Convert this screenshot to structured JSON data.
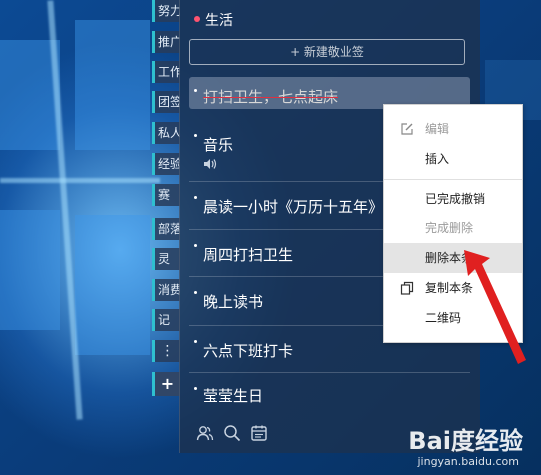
{
  "side_tabs": [
    {
      "label": "努力"
    },
    {
      "label": "推广"
    },
    {
      "label": "工作"
    },
    {
      "label": "团签"
    },
    {
      "label": "私人"
    },
    {
      "label": "经验"
    },
    {
      "label": "赛"
    },
    {
      "label": "部落"
    },
    {
      "label": "灵"
    },
    {
      "label": "消费"
    },
    {
      "label": "记"
    }
  ],
  "side_more": "⋮",
  "side_add": "+",
  "panel": {
    "title": "生活",
    "new_button": "+ 新建敬业签",
    "tasks": [
      {
        "label": "打扫卫生，七点起床"
      },
      {
        "label": "音乐"
      },
      {
        "label": "晨读一小时《万历十五年》"
      },
      {
        "label": "周四打扫卫生"
      },
      {
        "label": "晚上读书"
      },
      {
        "label": "六点下班打卡"
      },
      {
        "label": "莹莹生日"
      }
    ]
  },
  "context_menu": {
    "items": [
      {
        "label": "编辑",
        "state": "disabled",
        "icon": "edit-icon"
      },
      {
        "label": "插入",
        "state": "enabled"
      },
      {
        "label": "已完成撤销",
        "state": "enabled"
      },
      {
        "label": "完成删除",
        "state": "disabled"
      },
      {
        "label": "删除本条",
        "state": "enabled"
      },
      {
        "label": "复制本条",
        "state": "enabled",
        "icon": "copy-icon"
      },
      {
        "label": "二维码",
        "state": "enabled"
      }
    ]
  },
  "watermark": {
    "logo": "Bai度经验",
    "url": "jingyan.baidu.com"
  },
  "colors": {
    "accent_red": "#e02020",
    "tab_stripe": "#2fc0d0",
    "title_dot": "#ff5470"
  }
}
